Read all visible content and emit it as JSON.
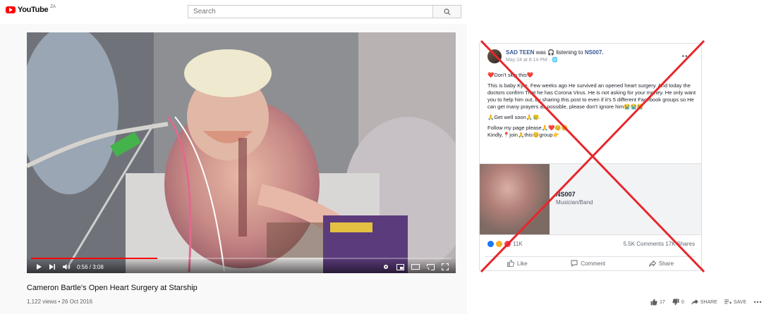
{
  "header": {
    "logo_text": "YouTube",
    "region": "ZA",
    "search_placeholder": "Search"
  },
  "player": {
    "time": "0:56 / 3:08",
    "progress": 0.3
  },
  "video": {
    "title": "Cameron Bartle's Open Heart Surgery at Starship",
    "meta": "1,122 views • 26 Oct 2016",
    "likes": "17",
    "dislikes": "0",
    "share_label": "SHARE",
    "save_label": "SAVE"
  },
  "facebook": {
    "author": "SAD TEEN",
    "activity": "was 🎧 listening to",
    "activity_target": "NS007.",
    "timestamp": "May 24 at 8:14 PM · 🌐",
    "paragraphs": [
      "❤️Don't skip this❤️",
      "This is baby Kyle. Few weeks ago He survived an opened heart surgery. And today the doctors confirm That he has Corona Virus. He is not asking for your money. He only want you to help him out, by sharing this post to even if it's 5 different Facebook groups so He can get many prayers as possible, please don't ignore him😭😭😭",
      "🙏Get well soon🙏😢.",
      "Follow my page please🙏❤️😊😊\nKindly,📍join🙏this😊group👉"
    ],
    "link_title": "NS007",
    "link_category": "Musician/Band",
    "reaction_count": "11K",
    "comments": "5.5K Comments",
    "shares": "17K Shares",
    "like_label": "Like",
    "comment_label": "Comment",
    "share_label": "Share"
  },
  "colors": {
    "youtube_red": "#ff0000",
    "cross_red": "#e8262b",
    "fb_blue": "#385898"
  }
}
